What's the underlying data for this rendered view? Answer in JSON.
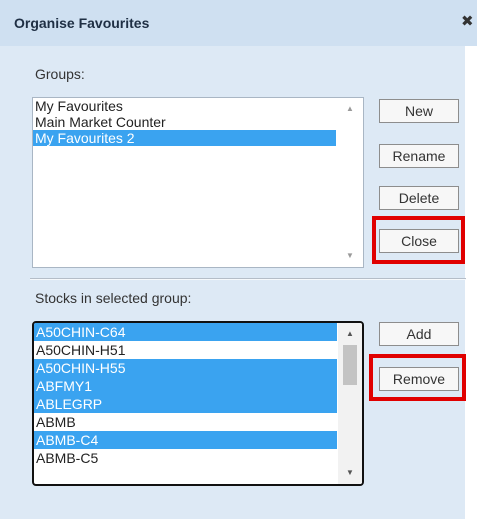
{
  "dialog": {
    "title": "Organise Favourites",
    "close_symbol": "✖"
  },
  "groups": {
    "label": "Groups:",
    "items": [
      {
        "label": "My Favourites",
        "selected": false
      },
      {
        "label": "Main Market Counter",
        "selected": false
      },
      {
        "label": "My Favourites 2",
        "selected": true
      }
    ]
  },
  "group_buttons": {
    "new": "New",
    "rename": "Rename",
    "delete": "Delete",
    "close": "Close"
  },
  "stocks": {
    "label": "Stocks in selected group:",
    "items": [
      {
        "label": "A50CHIN-C64",
        "selected": true
      },
      {
        "label": "A50CHIN-H51",
        "selected": false
      },
      {
        "label": "A50CHIN-H55",
        "selected": true
      },
      {
        "label": "ABFMY1",
        "selected": true
      },
      {
        "label": "ABLEGRP",
        "selected": true
      },
      {
        "label": "ABMB",
        "selected": false
      },
      {
        "label": "ABMB-C4",
        "selected": true
      },
      {
        "label": "ABMB-C5",
        "selected": false
      }
    ]
  },
  "stock_buttons": {
    "add": "Add",
    "remove": "Remove"
  },
  "scroll": {
    "up_symbol": "▲",
    "down_symbol": "▼"
  },
  "colors": {
    "dialog_bg": "#dde9f5",
    "selection": "#3aa3f0",
    "highlight": "#e00000"
  }
}
